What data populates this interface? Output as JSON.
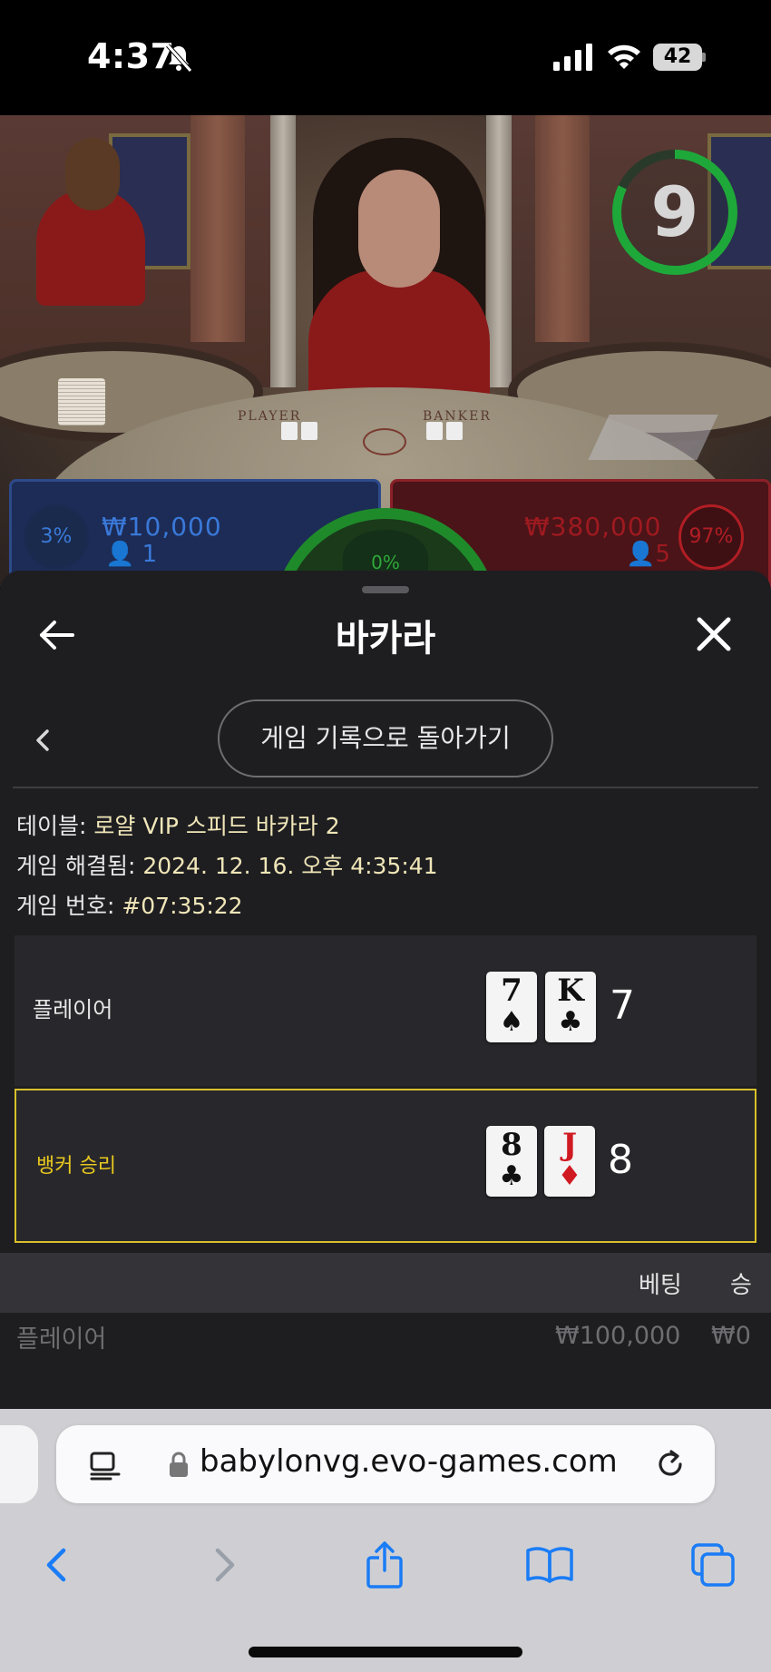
{
  "status_bar": {
    "time": "4:37",
    "battery": "42"
  },
  "video": {
    "timer": "9",
    "table_label_player": "PLAYER",
    "table_label_banker": "BANKER",
    "player_bet": {
      "percent": "3%",
      "amount": "₩10,000",
      "count": "1"
    },
    "banker_bet": {
      "percent": "97%",
      "amount": "₩380,000",
      "count": "5"
    },
    "tie_bet": {
      "percent": "0%"
    }
  },
  "sheet": {
    "title": "바카라",
    "back_to_history": "게임 기록으로 돌아가기",
    "table_label": "테이블:",
    "table_value": "로얄 VIP 스피드 바카라 2",
    "resolved_label": "게임 해결됨:",
    "resolved_value": "2024. 12. 16. 오후 4:35:41",
    "game_number_label": "게임 번호:",
    "game_number_value": "#07:35:22",
    "player_row": {
      "label": "플레이어",
      "cards": [
        {
          "rank": "7",
          "suit": "♠"
        },
        {
          "rank": "K",
          "suit": "♣"
        }
      ],
      "score": "7"
    },
    "banker_row": {
      "label": "뱅커 승리",
      "cards": [
        {
          "rank": "8",
          "suit": "♣"
        },
        {
          "rank": "J",
          "suit": "♦"
        }
      ],
      "score": "8"
    },
    "bet_table": {
      "col_betting": "베팅",
      "col_win": "승",
      "rows": [
        {
          "label": "플레이어",
          "amount": "₩100,000",
          "win": "₩0"
        }
      ]
    },
    "colors": {
      "winner_highlight": "#d8c02a",
      "player_blue": "#3a78d8",
      "banker_red": "#b01e24",
      "tie_green": "#1f8a2a"
    }
  },
  "browser": {
    "url": "babylonvg.evo-games.com"
  }
}
